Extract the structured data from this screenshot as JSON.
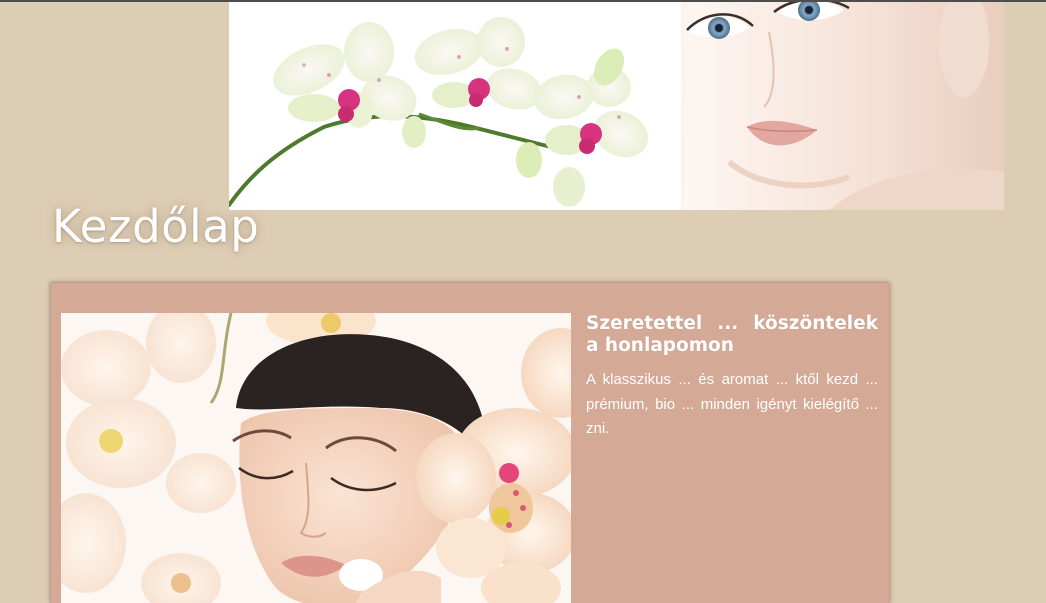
{
  "page": {
    "title": "Kezdőlap"
  },
  "banner": {
    "left_image": "white-orchid-branch-photo",
    "right_image": "woman-face-portrait-photo"
  },
  "card": {
    "heading": "Szeretettel ... köszöntelek a honlapomon",
    "paragraphs": [
      "A klasszikus ... és aromat ... ktől kezd ... prémium, bio ... minden igényt kielégítő ... zni."
    ],
    "photo": "woman-facial-treatment-with-orchids-photo"
  },
  "colors": {
    "page_background": "#decdb5",
    "card_background": "#d4a996",
    "text": "#ffffff"
  }
}
